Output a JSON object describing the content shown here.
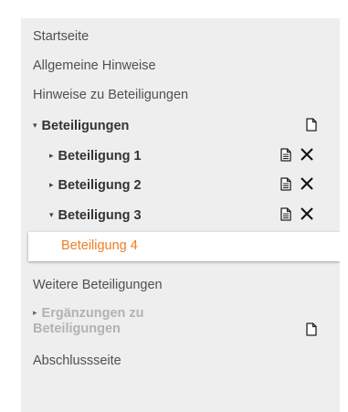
{
  "nav": {
    "startseite": "Startseite",
    "allgemeine_hinweise": "Allgemeine Hinweise",
    "hinweise_beteiligungen": "Hinweise zu Beteiligungen",
    "beteiligungen": "Beteiligungen",
    "beteiligung_1": "Beteiligung 1",
    "beteiligung_2": "Beteiligung 2",
    "beteiligung_3": "Beteiligung 3",
    "beteiligung_4": "Beteiligung 4",
    "weitere_beteiligungen": "Weitere Beteiligungen",
    "ergaenzungen_line1": "Ergänzungen zu",
    "ergaenzungen_line2": "Beteiligungen",
    "abschlussseite": "Abschlussseite"
  },
  "icons": {
    "collapsed": "▸",
    "expanded": "▾",
    "new_document": "new-document-icon",
    "document": "document-icon",
    "delete": "delete-x-icon"
  },
  "colors": {
    "panel_bg": "#eeeeee",
    "active_text": "#ef7d22",
    "disabled_text": "#b2b2b2",
    "text": "#333333"
  }
}
